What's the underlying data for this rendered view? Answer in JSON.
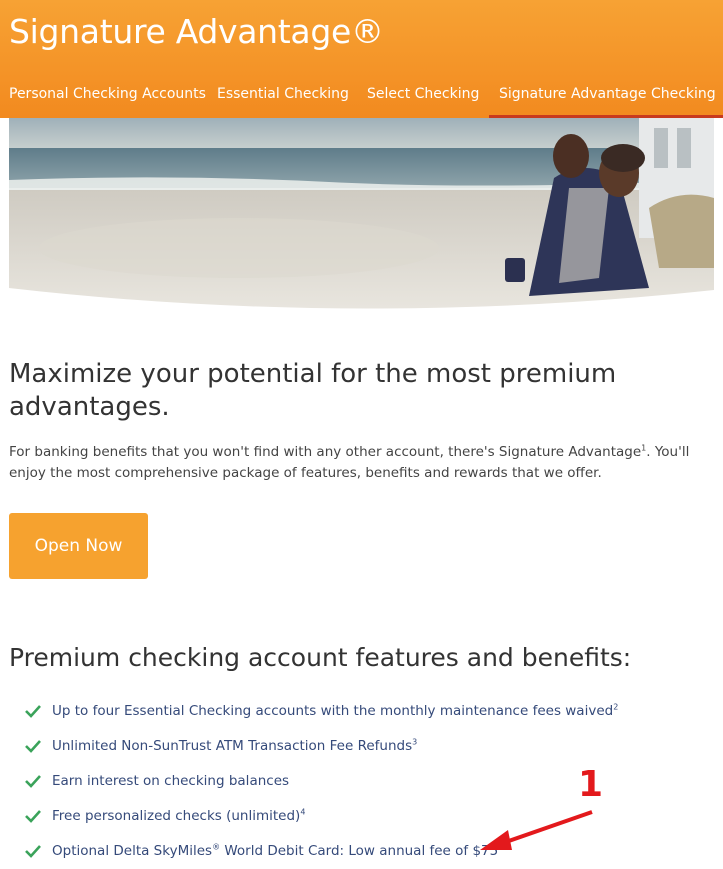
{
  "header": {
    "title": "Signature Advantage®"
  },
  "nav": {
    "tabs": [
      {
        "label": "Personal Checking Accounts"
      },
      {
        "label": "Essential Checking"
      },
      {
        "label": "Select Checking"
      },
      {
        "label": "Signature Advantage Checking",
        "active": true
      }
    ]
  },
  "hero": {
    "image": "couple-on-beach-photo"
  },
  "main": {
    "headline": "Maximize your potential for the most premium advantages.",
    "intro_part1": "For banking benefits that you won't find with any other account, there's Signature Advantage",
    "intro_sup": "1",
    "intro_part2": ". You'll enjoy the most comprehensive package of features, benefits and rewards that we offer.",
    "open_button": "Open Now",
    "features_heading": "Premium checking account features and benefits:",
    "features": [
      {
        "text": "Up to four Essential Checking accounts with the monthly maintenance fees waived",
        "sup": "2"
      },
      {
        "text": "Unlimited Non-SunTrust ATM Transaction Fee Refunds",
        "sup": "3"
      },
      {
        "text": "Earn interest on checking balances",
        "sup": ""
      },
      {
        "text": "Free personalized checks (unlimited)",
        "sup": "4"
      },
      {
        "text_a": "Optional Delta SkyMiles",
        "reg": "®",
        "text_b": " World Debit Card: Low annual fee of $75",
        "sup": "5"
      }
    ]
  },
  "annotation": {
    "number": "1"
  },
  "colors": {
    "brand_orange": "#f39425",
    "check_green": "#3aa35a",
    "link_blue": "#354a7a",
    "annotation_red": "#e3191c"
  }
}
